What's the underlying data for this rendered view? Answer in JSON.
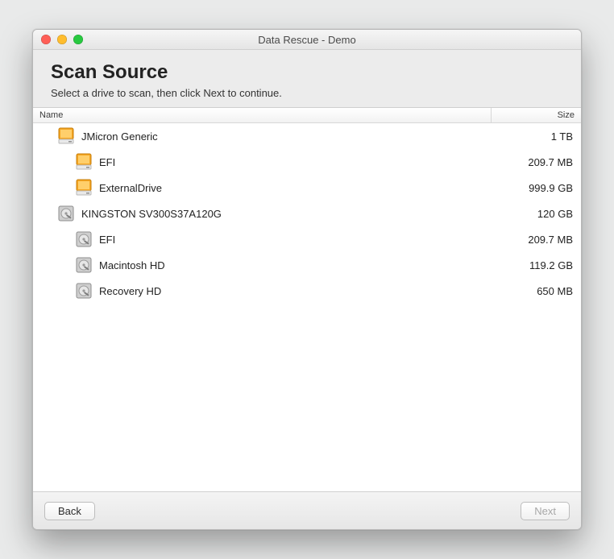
{
  "window": {
    "title": "Data Rescue - Demo"
  },
  "header": {
    "title": "Scan Source",
    "subtitle": "Select a drive to scan, then click Next to continue."
  },
  "columns": {
    "name": "Name",
    "size": "Size"
  },
  "drives": [
    {
      "name": "JMicron Generic",
      "size": "1 TB",
      "icon": "external-drive-icon",
      "volumes": [
        {
          "name": "EFI",
          "size": "209.7 MB",
          "icon": "external-volume-icon"
        },
        {
          "name": "ExternalDrive",
          "size": "999.9 GB",
          "icon": "external-volume-icon"
        }
      ]
    },
    {
      "name": "KINGSTON SV300S37A120G",
      "size": "120 GB",
      "icon": "internal-drive-icon",
      "volumes": [
        {
          "name": "EFI",
          "size": "209.7 MB",
          "icon": "internal-volume-icon"
        },
        {
          "name": "Macintosh HD",
          "size": "119.2 GB",
          "icon": "internal-volume-icon"
        },
        {
          "name": "Recovery HD",
          "size": "650 MB",
          "icon": "internal-volume-icon"
        }
      ]
    }
  ],
  "buttons": {
    "back": "Back",
    "next": "Next"
  }
}
